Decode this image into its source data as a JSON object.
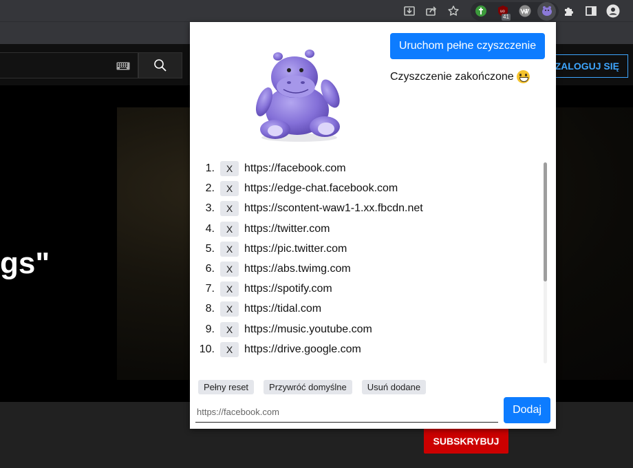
{
  "browser": {
    "extension_badge": "41"
  },
  "youtube": {
    "login_label": "ZALOGUJ SIĘ",
    "video_title_fragment": "gs\"",
    "subscribe_label": "SUBSKRYBUJ"
  },
  "popup": {
    "run_button": "Uruchom pełne czyszczenie",
    "status_text": "Czyszczenie zakończone",
    "list": [
      {
        "num": "1.",
        "url": "https://facebook.com"
      },
      {
        "num": "2.",
        "url": "https://edge-chat.facebook.com"
      },
      {
        "num": "3.",
        "url": "https://scontent-waw1-1.xx.fbcdn.net"
      },
      {
        "num": "4.",
        "url": "https://twitter.com"
      },
      {
        "num": "5.",
        "url": "https://pic.twitter.com"
      },
      {
        "num": "6.",
        "url": "https://abs.twimg.com"
      },
      {
        "num": "7.",
        "url": "https://spotify.com"
      },
      {
        "num": "8.",
        "url": "https://tidal.com"
      },
      {
        "num": "9.",
        "url": "https://music.youtube.com"
      },
      {
        "num": "10.",
        "url": "https://drive.google.com"
      }
    ],
    "remove_label": "X",
    "buttons": {
      "full_reset": "Pełny reset",
      "restore_defaults": "Przywróć domyślne",
      "remove_added": "Usuń dodane"
    },
    "input_placeholder": "https://facebook.com",
    "add_button": "Dodaj"
  },
  "colors": {
    "accent_blue": "#0d7cff",
    "youtube_red": "#cc0000",
    "youtube_link_blue": "#3ea6ff"
  }
}
